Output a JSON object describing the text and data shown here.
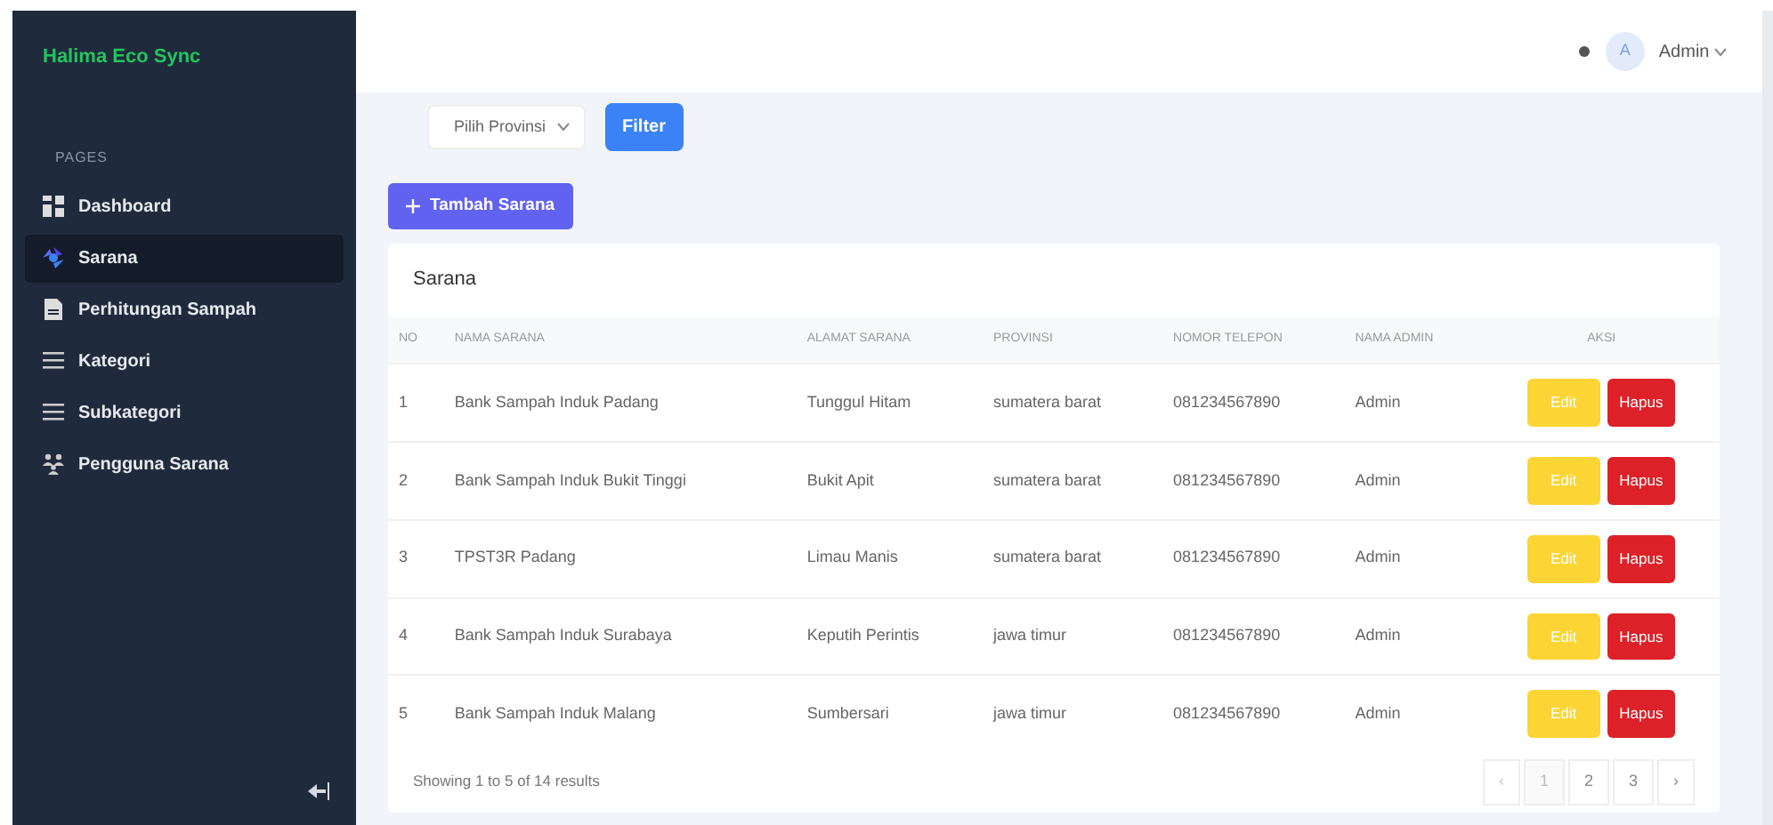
{
  "brand": "Halima Eco Sync",
  "sidebar": {
    "section": "PAGES",
    "items": [
      {
        "label": "Dashboard",
        "selected": false
      },
      {
        "label": "Sarana",
        "selected": true
      },
      {
        "label": "Perhitungan Sampah",
        "selected": false
      },
      {
        "label": "Kategori",
        "selected": false
      },
      {
        "label": "Subkategori",
        "selected": false
      },
      {
        "label": "Pengguna Sarana",
        "selected": false
      }
    ]
  },
  "header": {
    "avatar": "A",
    "user": "Admin"
  },
  "filter": {
    "province": "Pilih Provinsi",
    "button": "Filter"
  },
  "add_button": "Tambah Sarana",
  "card_title": "Sarana",
  "table": {
    "columns": [
      "NO",
      "NAMA SARANA",
      "ALAMAT SARANA",
      "PROVINSI",
      "NOMOR TELEPON",
      "NAMA ADMIN",
      "AKSI"
    ],
    "rows": [
      {
        "no": "1",
        "name": "Bank Sampah Induk Padang",
        "address": "Tunggul Hitam",
        "province": "sumatera barat",
        "phone": "081234567890",
        "admin": "Admin",
        "edit": "Edit",
        "delete": "Hapus"
      },
      {
        "no": "2",
        "name": "Bank Sampah Induk Bukit Tinggi",
        "address": "Bukit Apit",
        "province": "sumatera barat",
        "phone": "081234567890",
        "admin": "Admin",
        "edit": "Edit",
        "delete": "Hapus"
      },
      {
        "no": "3",
        "name": "TPST3R Padang",
        "address": "Limau Manis",
        "province": "sumatera barat",
        "phone": "081234567890",
        "admin": "Admin",
        "edit": "Edit",
        "delete": "Hapus"
      },
      {
        "no": "4",
        "name": "Bank Sampah Induk Surabaya",
        "address": "Keputih Perintis",
        "province": "jawa timur",
        "phone": "081234567890",
        "admin": "Admin",
        "edit": "Edit",
        "delete": "Hapus"
      },
      {
        "no": "5",
        "name": "Bank Sampah Induk Malang",
        "address": "Sumbersari",
        "province": "jawa timur",
        "phone": "081234567890",
        "admin": "Admin",
        "edit": "Edit",
        "delete": "Hapus"
      }
    ]
  },
  "summary": "Showing 1 to 5 of 14 results",
  "pagination": {
    "prev": "‹",
    "next": "›",
    "pages": [
      {
        "label": "1",
        "selected": true
      },
      {
        "label": "2",
        "selected": false
      },
      {
        "label": "3",
        "selected": false
      }
    ]
  }
}
